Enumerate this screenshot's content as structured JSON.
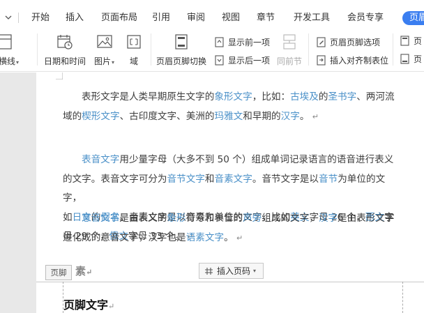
{
  "tabs": [
    "开始",
    "插入",
    "页面布局",
    "引用",
    "审阅",
    "视图",
    "章节",
    "开发工具",
    "会员专享",
    "页眉"
  ],
  "ribbon": {
    "border_line_label": "眉横线",
    "date_time": "日期和时间",
    "picture": "图片",
    "field": "域",
    "switch_header_footer": "页眉页脚切换",
    "show_previous": "显示前一项",
    "show_next": "显示后一项",
    "same_as_previous": "同前节",
    "header_footer_options": "页眉页脚选项",
    "insert_align_tab": "插入对齐制表位",
    "page_right_1": "页",
    "page_right_2": "页"
  },
  "document": {
    "para_marker": "↵",
    "p1": {
      "t1": "表形文字是人类早期原生文字的",
      "l1": "象形文字",
      "t2": "，比如：",
      "l2": "古埃及",
      "t3": "的",
      "l3": "圣书字",
      "t4": "、两河流",
      "t5": "域的",
      "l4": "楔形文字",
      "t6": "、古印度文字、美洲的",
      "l5": "玛雅文",
      "t7": "和早期的",
      "l6": "汉字",
      "t8": "。"
    },
    "p2": {
      "l1": "表音文字",
      "t1": "用少量字母（大多不到 50 个）组成单词记录语言的语音进行表义",
      "t2": "的文字。表音文字可分为",
      "l2": "音节文字",
      "t3": "和",
      "l3": "音素文字",
      "t4": "。音节文字是以",
      "l4": "音节",
      "t5": "为单位的文字，",
      "t6": "如",
      "l5": "日文",
      "t7": "的",
      "l6": "假名",
      "t8": "。音素文字是以音素为单位的文字，比如",
      "l7": "英文",
      "t9": "字母 26 个，",
      "l8": "西文",
      "t10": "字",
      "t11": "母 29 个，",
      "l9": "俄文",
      "t12": "字母 33 个。"
    },
    "p3": {
      "l1": "意音文字",
      "t1": "是由表义的",
      "l2": "象形",
      "t2": "符号和表音的",
      "l3": "声旁",
      "t3": "组成的文字，",
      "l4": "汉字",
      "t4": "是由表形文字",
      "t5": "进化成的意音文字，汉字也是",
      "l5": "语素文字",
      "t6": "。"
    },
    "partial_char": "素",
    "footer_label": "页脚",
    "insert_page_number": "插入页码",
    "footer_text": "页脚文字"
  },
  "colors": {
    "link": "#4a90c8",
    "active_tab": "#3a7ef0",
    "doc_background": "#e8e8e8"
  }
}
